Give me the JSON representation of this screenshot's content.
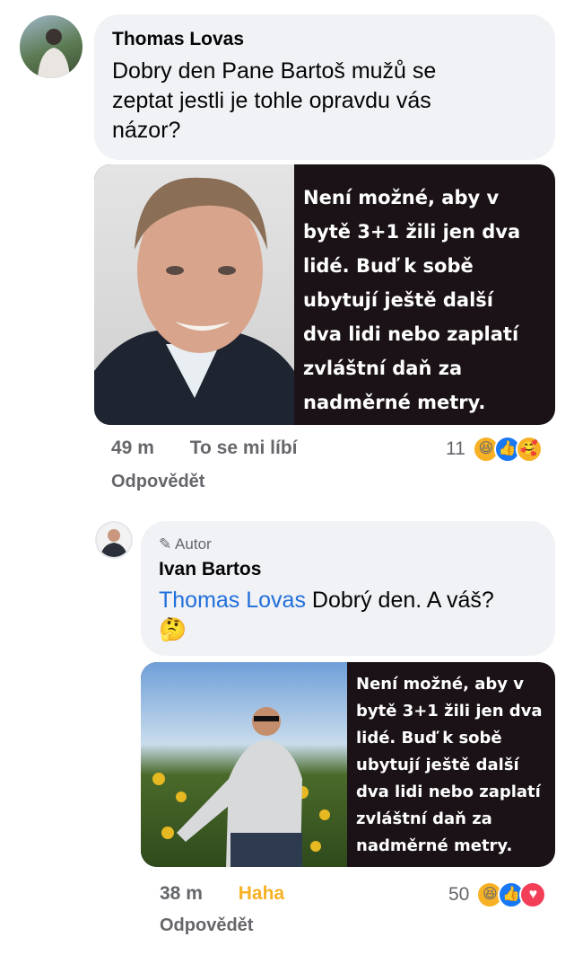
{
  "comment1": {
    "author": "Thomas Lovas",
    "text": "Dobry den Pane Bartoš mužů se zeptat jestli je tohle opravdu vás názor?",
    "image_quote": "Není možné, aby v\nbytě 3+1 žili jen dva\nlidé. Buď k sobě\nubytují ještě další\ndva lidi nebo zaplatí\nzvláštní daň za\nnadměrné metry.",
    "time": "49 m",
    "like_label": "To se mi líbí",
    "reaction_count": "11",
    "reply_label": "Odpovědět",
    "reactions": [
      "haha-icon",
      "like-icon",
      "love-icon"
    ]
  },
  "comment2": {
    "author_badge": "Autor",
    "author": "Ivan Bartos",
    "mention": "Thomas Lovas",
    "text": "Dobrý den. A váš?",
    "emoji": "🤔",
    "image_quote": "Není možné, aby v\nbytě 3+1 žili jen dva\nlidé. Buď k sobě\nubytují ještě další\ndva lidi nebo zaplatí\nzvláštní daň za\nnadměrné metry.",
    "time": "38 m",
    "like_label": "Haha",
    "reaction_count": "50",
    "reply_label": "Odpovědět",
    "reactions": [
      "haha-icon",
      "like-icon",
      "love-icon"
    ]
  },
  "colors": {
    "bubble": "#f0f2f5",
    "mention": "#216fdb",
    "haha_label": "#f7b125",
    "like_blue": "#1877f2",
    "love_red": "#f33e58"
  }
}
